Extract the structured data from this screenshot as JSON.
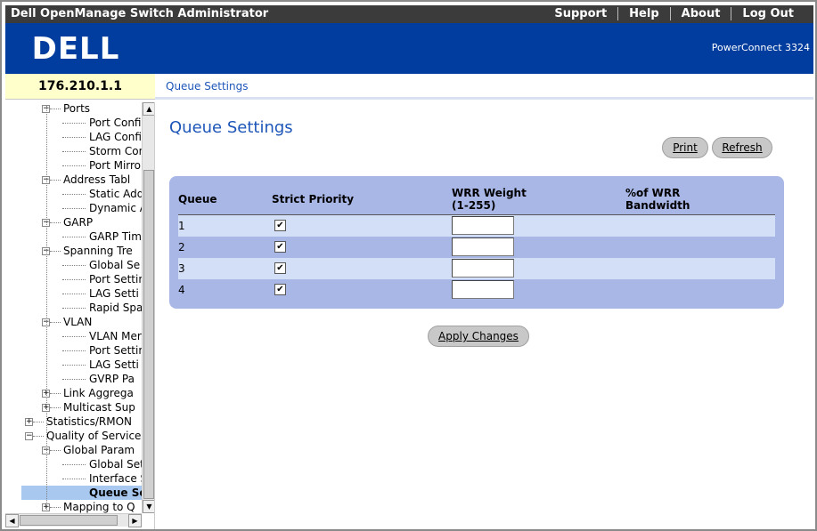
{
  "header": {
    "app_title": "Dell OpenManage Switch Administrator",
    "links": [
      "Support",
      "Help",
      "About",
      "Log Out"
    ],
    "model": "PowerConnect 3324",
    "logo_text": "DELL"
  },
  "device": {
    "ip": "176.210.1.1"
  },
  "breadcrumb": "Queue Settings",
  "tree": {
    "nodes": [
      {
        "label": "Ports",
        "level": 2,
        "toggle": "minus"
      },
      {
        "label": "Port Confi",
        "level": 3
      },
      {
        "label": "LAG Confi",
        "level": 3
      },
      {
        "label": "Storm Con",
        "level": 3
      },
      {
        "label": "Port Mirro",
        "level": 3
      },
      {
        "label": "Address Tabl",
        "level": 2,
        "toggle": "minus"
      },
      {
        "label": "Static Add",
        "level": 3
      },
      {
        "label": "Dynamic A",
        "level": 3
      },
      {
        "label": "GARP",
        "level": 2,
        "toggle": "minus"
      },
      {
        "label": "GARP Tim",
        "level": 3
      },
      {
        "label": "Spanning Tre",
        "level": 2,
        "toggle": "minus"
      },
      {
        "label": "Global Se",
        "level": 3
      },
      {
        "label": "Port Settin",
        "level": 3
      },
      {
        "label": "LAG Setti",
        "level": 3
      },
      {
        "label": "Rapid Spa",
        "level": 3
      },
      {
        "label": "VLAN",
        "level": 2,
        "toggle": "minus"
      },
      {
        "label": "VLAN Mer",
        "level": 3
      },
      {
        "label": "Port Settin",
        "level": 3
      },
      {
        "label": "LAG Setti",
        "level": 3
      },
      {
        "label": "GVRP Pa",
        "level": 3
      },
      {
        "label": "Link Aggrega",
        "level": 2,
        "toggle": "plus"
      },
      {
        "label": "Multicast Sup",
        "level": 2,
        "toggle": "plus"
      },
      {
        "label": "Statistics/RMON",
        "level": 1,
        "toggle": "plus"
      },
      {
        "label": "Quality of Service",
        "level": 1,
        "toggle": "minus"
      },
      {
        "label": "Global Param",
        "level": 2,
        "toggle": "minus"
      },
      {
        "label": "Global Set",
        "level": 3
      },
      {
        "label": "Interface S",
        "level": 3
      },
      {
        "label": "Queue Se",
        "level": 3,
        "selected": true
      },
      {
        "label": "Mapping to Q",
        "level": 2,
        "toggle": "plus"
      }
    ]
  },
  "main": {
    "title": "Queue Settings",
    "print_label": "Print",
    "refresh_label": "Refresh",
    "apply_label": "Apply Changes",
    "table": {
      "headers": {
        "queue": "Queue",
        "strict_priority": "Strict Priority",
        "wrr_weight_line1": "WRR Weight",
        "wrr_weight_line2": "(1-255)",
        "bandwidth_line1": "%of WRR",
        "bandwidth_line2": "Bandwidth"
      },
      "rows": [
        {
          "queue": "1",
          "strict_priority": true,
          "wrr_weight": ""
        },
        {
          "queue": "2",
          "strict_priority": true,
          "wrr_weight": ""
        },
        {
          "queue": "3",
          "strict_priority": true,
          "wrr_weight": ""
        },
        {
          "queue": "4",
          "strict_priority": true,
          "wrr_weight": ""
        }
      ]
    }
  }
}
